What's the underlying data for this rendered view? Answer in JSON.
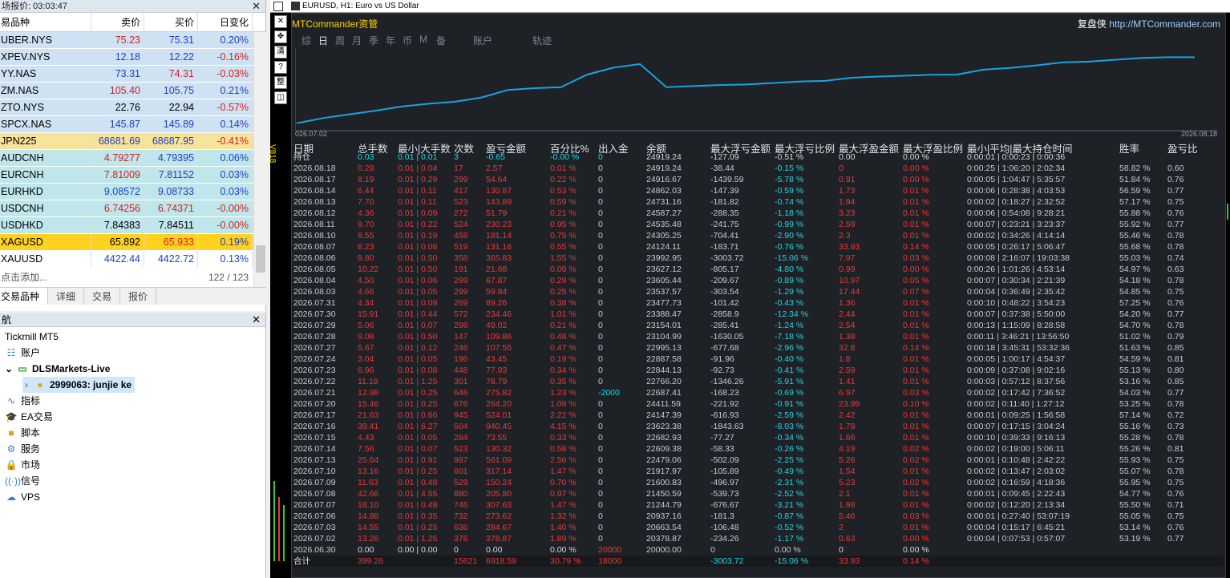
{
  "market_watch": {
    "title": "场报价: 03:03:47",
    "headers": [
      "易品种",
      "卖价",
      "买价",
      "日变化"
    ],
    "rows": [
      {
        "symbol": "UBER.NYS",
        "bid": "75.23",
        "ask": "75.31",
        "change": "0.20%",
        "bg": "#cfe2f3",
        "bid_color": "#d42020",
        "ask_color": "#1f3fbf",
        "chg_color": "#1f3fbf"
      },
      {
        "symbol": "XPEV.NYS",
        "bid": "12.18",
        "ask": "12.22",
        "change": "-0.16%",
        "bg": "#cfe2f3",
        "bid_color": "#1f3fbf",
        "ask_color": "#1f3fbf",
        "chg_color": "#d42020"
      },
      {
        "symbol": "YY.NAS",
        "bid": "73.31",
        "ask": "74.31",
        "change": "-0.03%",
        "bg": "#cfe2f3",
        "bid_color": "#1f3fbf",
        "ask_color": "#d42020",
        "chg_color": "#d42020"
      },
      {
        "symbol": "ZM.NAS",
        "bid": "105.40",
        "ask": "105.75",
        "change": "0.21%",
        "bg": "#cfe2f3",
        "bid_color": "#d42020",
        "ask_color": "#1f3fbf",
        "chg_color": "#1f3fbf"
      },
      {
        "symbol": "ZTO.NYS",
        "bid": "22.76",
        "ask": "22.94",
        "change": "-0.57%",
        "bg": "#cfe2f3",
        "bid_color": "#000000",
        "ask_color": "#000000",
        "chg_color": "#d42020"
      },
      {
        "symbol": "SPCX.NAS",
        "bid": "145.87",
        "ask": "145.89",
        "change": "0.14%",
        "bg": "#cfe2f3",
        "bid_color": "#1f3fbf",
        "ask_color": "#1f3fbf",
        "chg_color": "#1f3fbf"
      },
      {
        "symbol": "JPN225",
        "bid": "68681.69",
        "ask": "68687.95",
        "change": "-0.41%",
        "bg": "#f7e39a",
        "bid_color": "#1f3fbf",
        "ask_color": "#1f3fbf",
        "chg_color": "#d42020"
      },
      {
        "symbol": "AUDCNH",
        "bid": "4.79277",
        "ask": "4.79395",
        "change": "0.06%",
        "bg": "#bfe6ea",
        "bid_color": "#d42020",
        "ask_color": "#1f3fbf",
        "chg_color": "#1f3fbf"
      },
      {
        "symbol": "EURCNH",
        "bid": "7.81009",
        "ask": "7.81152",
        "change": "0.03%",
        "bg": "#bfe6ea",
        "bid_color": "#d42020",
        "ask_color": "#1f3fbf",
        "chg_color": "#1f3fbf"
      },
      {
        "symbol": "EURHKD",
        "bid": "9.08572",
        "ask": "9.08733",
        "change": "0.03%",
        "bg": "#bfe6ea",
        "bid_color": "#1f3fbf",
        "ask_color": "#1f3fbf",
        "chg_color": "#1f3fbf"
      },
      {
        "symbol": "USDCNH",
        "bid": "6.74256",
        "ask": "6.74371",
        "change": "-0.00%",
        "bg": "#bfe6ea",
        "bid_color": "#d42020",
        "ask_color": "#d42020",
        "chg_color": "#d42020"
      },
      {
        "symbol": "USDHKD",
        "bid": "7.84383",
        "ask": "7.84511",
        "change": "-0.00%",
        "bg": "#bfe6ea",
        "bid_color": "#000000",
        "ask_color": "#000000",
        "chg_color": "#d42020"
      },
      {
        "symbol": "XAGUSD",
        "bid": "65.892",
        "ask": "65.933",
        "change": "0.19%",
        "bg": "#ffd21f",
        "bid_color": "#000000",
        "ask_color": "#d42020",
        "chg_color": "#1f3fbf"
      },
      {
        "symbol": "XAUUSD",
        "bid": "4422.44",
        "ask": "4422.72",
        "change": "0.13%",
        "bg": "#ffffff",
        "bid_color": "#1f3fbf",
        "ask_color": "#1f3fbf",
        "chg_color": "#1f3fbf"
      }
    ],
    "add_hint": "点击添加...",
    "count": "122 / 123",
    "tabs": [
      "交易品种",
      "详细",
      "交易",
      "报价"
    ]
  },
  "navigator": {
    "title": "航",
    "broker": "Tickmill MT5",
    "items": [
      {
        "label": "账户",
        "icon": "accounts-icon"
      },
      {
        "label": "DLSMarkets-Live",
        "icon": "server-icon"
      },
      {
        "label": "2999063: junjie ke",
        "icon": "user-icon"
      },
      {
        "label": "指标",
        "icon": "indicator-icon"
      },
      {
        "label": "EA交易",
        "icon": "expert-icon"
      },
      {
        "label": "脚本",
        "icon": "script-icon"
      },
      {
        "label": "服务",
        "icon": "service-icon"
      },
      {
        "label": "市场",
        "icon": "market-icon"
      },
      {
        "label": "信号",
        "icon": "signal-icon"
      },
      {
        "label": "VPS",
        "icon": "cloud-icon"
      }
    ]
  },
  "chart_window": {
    "title": "EURUSD, H1:  Euro vs US Dollar",
    "side_label": "V818",
    "toolbar": [
      "✕",
      "✥",
      "清",
      "?",
      "整",
      "◫"
    ]
  },
  "panel": {
    "app_name": "MTCommander资管",
    "brand_cn": "复盘侠",
    "brand_url": "http://MTCommander.com",
    "periods": [
      "综",
      "日",
      "周",
      "月",
      "季",
      "年",
      "币",
      "M",
      "备"
    ],
    "period_selected": 1,
    "account_tab": "账户",
    "track_tab": "轨迹",
    "curve_start": "026.07.02",
    "curve_end": "2026.08.18"
  },
  "chart_data": {
    "type": "line",
    "x": [
      "2026.06.30",
      "2026.07.02",
      "2026.07.03",
      "2026.07.06",
      "2026.07.07",
      "2026.07.08",
      "2026.07.09",
      "2026.07.10",
      "2026.07.13",
      "2026.07.14",
      "2026.07.15",
      "2026.07.16",
      "2026.07.17",
      "2026.07.20",
      "2026.07.21",
      "2026.07.22",
      "2026.07.23",
      "2026.07.24",
      "2026.07.27",
      "2026.07.28",
      "2026.07.29",
      "2026.07.30",
      "2026.07.31",
      "2026.08.03",
      "2026.08.04",
      "2026.08.05",
      "2026.08.06",
      "2026.08.07",
      "2026.08.10",
      "2026.08.11",
      "2026.08.12",
      "2026.08.13",
      "2026.08.14",
      "2026.08.17",
      "2026.08.18"
    ],
    "values": [
      20000.0,
      20378.87,
      20663.54,
      20937.16,
      21244.79,
      21450.59,
      21600.83,
      21917.97,
      22479.06,
      22609.38,
      22682.93,
      23623.38,
      24147.39,
      24411.59,
      22687.41,
      22766.2,
      22844.13,
      22887.58,
      22995.13,
      23104.99,
      23154.01,
      23388.47,
      23477.73,
      23537.57,
      23605.44,
      23627.12,
      23992.95,
      24124.11,
      24305.25,
      24535.48,
      24587.27,
      24731.16,
      24862.03,
      24916.67,
      24919.24
    ]
  },
  "table": {
    "headers": [
      "日期",
      "总手数",
      "最小|大手数",
      "次数",
      "盈亏金额",
      "百分比%",
      "出入金",
      "余额",
      "最大浮亏金额",
      "最大浮亏比例",
      "最大浮盈金额",
      "最大浮盈比例",
      "最小|平均|最大持仓时间",
      "胜率",
      "盈亏比"
    ],
    "holding": {
      "label": "持仓",
      "lots": "0.03",
      "minmax": "0.01 | 0.01",
      "count": "3",
      "pnl": "-0.65",
      "pct": "-0.00 %",
      "flow": "0",
      "balance": "24919.24",
      "ddamt": "-127.09",
      "ddpct": "-0.51 %",
      "fpamt": "0.00",
      "fppct": "0.00 %",
      "time": "0:00:01 | 0:00:23 | 0:00:36",
      "win": "",
      "ratio": ""
    },
    "rows": [
      [
        "2026.08.18",
        "0.29",
        "0.01 | 0.04",
        "17",
        "2.57",
        "0.01 %",
        "0",
        "24919.24",
        "-38.44",
        "-0.15 %",
        "0",
        "0.00 %",
        "0:00:25 | 1:06:20 | 2:02:34",
        "58.82 %",
        "0.60"
      ],
      [
        "2026.08.17",
        "8.19",
        "0.01 | 0.29",
        "299",
        "54.64",
        "0.22 %",
        "0",
        "24916.67",
        "-1439.59",
        "-5.78 %",
        "0.91",
        "0.00 %",
        "0:00:05 | 1:04:47 | 5:35:57",
        "51.84 %",
        "0.76"
      ],
      [
        "2026.08.14",
        "6.44",
        "0.01 | 0.11",
        "417",
        "130.87",
        "0.53 %",
        "0",
        "24862.03",
        "-147.39",
        "-0.59 %",
        "1.73",
        "0.01 %",
        "0:00:06 | 0:28:38 | 4:03:53",
        "56.59 %",
        "0.77"
      ],
      [
        "2026.08.13",
        "7.70",
        "0.01 | 0.11",
        "523",
        "143.89",
        "0.59 %",
        "0",
        "24731.16",
        "-181.82",
        "-0.74 %",
        "1.94",
        "0.01 %",
        "0:00:02 | 0:18:27 | 2:32:52",
        "57.17 %",
        "0.75"
      ],
      [
        "2026.08.12",
        "4.36",
        "0.01 | 0.09",
        "272",
        "51.79",
        "0.21 %",
        "0",
        "24587.27",
        "-288.35",
        "-1.18 %",
        "3.23",
        "0.01 %",
        "0:00:06 | 0:54:08 | 9:28:21",
        "55.88 %",
        "0.76"
      ],
      [
        "2026.08.11",
        "9.70",
        "0.01 | 0.22",
        "524",
        "230.23",
        "0.95 %",
        "0",
        "24535.48",
        "-241.75",
        "-0.99 %",
        "2.59",
        "0.01 %",
        "0:00:07 | 0:23:21 | 3:23:37",
        "55.92 %",
        "0.77"
      ],
      [
        "2026.08.10",
        "8.55",
        "0.01 | 0.19",
        "458",
        "181.14",
        "0.75 %",
        "0",
        "24305.25",
        "-704.41",
        "-2.90 %",
        "2.3",
        "0.01 %",
        "0:00:02 | 0:34:26 | 4:14:14",
        "55.46 %",
        "0.78"
      ],
      [
        "2026.08.07",
        "8.23",
        "0.01 | 0.08",
        "519",
        "131.16",
        "0.55 %",
        "0",
        "24124.11",
        "-183.71",
        "-0.76 %",
        "33.93",
        "0.14 %",
        "0:00:05 | 0:26:17 | 5:06:47",
        "55.68 %",
        "0.78"
      ],
      [
        "2026.08.06",
        "9.80",
        "0.01 | 0.50",
        "358",
        "365.83",
        "1.55 %",
        "0",
        "23992.95",
        "-3003.72",
        "-15.06 %",
        "7.97",
        "0.03 %",
        "0:00:08 | 2:16:07 | 19:03:38",
        "55.03 %",
        "0.74"
      ],
      [
        "2026.08.05",
        "10.22",
        "0.01 | 0.50",
        "191",
        "21.68",
        "0.09 %",
        "0",
        "23627.12",
        "-805.17",
        "-4.80 %",
        "0.99",
        "0.00 %",
        "0:00:26 | 1:01:26 | 4:53:14",
        "54.97 %",
        "0.63"
      ],
      [
        "2026.08.04",
        "4.50",
        "0.01 | 0.06",
        "299",
        "67.87",
        "0.29 %",
        "0",
        "23605.44",
        "-209.67",
        "-0.89 %",
        "10.97",
        "0.05 %",
        "0:00:07 | 0:30:34 | 2:21:39",
        "54.18 %",
        "0.78"
      ],
      [
        "2026.08.03",
        "4.66",
        "0.01 | 0.05",
        "299",
        "59.84",
        "0.25 %",
        "0",
        "23537.57",
        "-303.54",
        "-1.29 %",
        "17.44",
        "0.07 %",
        "0:00:04 | 0:36:49 | 2:35:42",
        "54.85 %",
        "0.75"
      ],
      [
        "2026.07.31",
        "4.34",
        "0.01 | 0.09",
        "269",
        "89.26",
        "0.38 %",
        "0",
        "23477.73",
        "-101.42",
        "-0.43 %",
        "1.36",
        "0.01 %",
        "0:00:10 | 0:48:22 | 3:54:23",
        "57.25 %",
        "0.76"
      ],
      [
        "2026.07.30",
        "15.91",
        "0.01 | 0.44",
        "572",
        "234.46",
        "1.01 %",
        "0",
        "23388.47",
        "-2858.9",
        "-12.34 %",
        "2.44",
        "0.01 %",
        "0:00:07 | 0:37:38 | 5:50:00",
        "54.20 %",
        "0.77"
      ],
      [
        "2026.07.29",
        "5.06",
        "0.01 | 0.07",
        "298",
        "49.02",
        "0.21 %",
        "0",
        "23154.01",
        "-285.41",
        "-1.24 %",
        "2.54",
        "0.01 %",
        "0:00:13 | 1:15:09 | 8:28:58",
        "54.70 %",
        "0.78"
      ],
      [
        "2026.07.28",
        "9.08",
        "0.01 | 0.50",
        "147",
        "109.86",
        "0.48 %",
        "0",
        "23104.99",
        "-1630.05",
        "-7.18 %",
        "1.38",
        "0.01 %",
        "0:00:11 | 3:46:21 | 13:56:50",
        "51.02 %",
        "0.79"
      ],
      [
        "2026.07.27",
        "5.67",
        "0.01 | 0.12",
        "246",
        "107.55",
        "0.47 %",
        "0",
        "22995.13",
        "-677.68",
        "-2.96 %",
        "32.8",
        "0.14 %",
        "0:00:18 | 3:45:31 | 53:32:36",
        "51.63 %",
        "0.85"
      ],
      [
        "2026.07.24",
        "3.04",
        "0.01 | 0.05",
        "196",
        "43.45",
        "0.19 %",
        "0",
        "22887.58",
        "-91.96",
        "-0.40 %",
        "1.8",
        "0.01 %",
        "0:00:05 | 1:00:17 | 4:54:37",
        "54.59 %",
        "0.81"
      ],
      [
        "2026.07.23",
        "6.96",
        "0.01 | 0.08",
        "448",
        "77.93",
        "0.34 %",
        "0",
        "22844.13",
        "-92.73",
        "-0.41 %",
        "2.59",
        "0.01 %",
        "0:00:09 | 0:37:08 | 9:02:16",
        "55.13 %",
        "0.80"
      ],
      [
        "2026.07.22",
        "11.18",
        "0.01 | 1.25",
        "301",
        "78.79",
        "0.35 %",
        "0",
        "22766.20",
        "-1346.26",
        "-5.91 %",
        "1.41",
        "0.01 %",
        "0:00:03 | 0:57:12 | 8:37:56",
        "53.16 %",
        "0.85"
      ],
      [
        "2026.07.21",
        "12.98",
        "0.01 | 0.25",
        "646",
        "275.82",
        "1.23 %",
        "-2000",
        "22687.41",
        "-168.23",
        "-0.69 %",
        "6.97",
        "0.03 %",
        "0:00:02 | 0:17:42 | 7:36:52",
        "54.03 %",
        "0.77"
      ],
      [
        "2026.07.20",
        "15.46",
        "0.01 | 0.25",
        "676",
        "264.20",
        "1.09 %",
        "0",
        "24411.59",
        "-221.92",
        "-0.91 %",
        "23.99",
        "0.10 %",
        "0:00:02 | 0:11:40 | 1:27:12",
        "53.25 %",
        "0.78"
      ],
      [
        "2026.07.17",
        "21.63",
        "0.01 | 0.66",
        "945",
        "524.01",
        "2.22 %",
        "0",
        "24147.39",
        "-616.93",
        "-2.59 %",
        "2.42",
        "0.01 %",
        "0:00:01 | 0:09:25 | 1:56:58",
        "57.14 %",
        "0.72"
      ],
      [
        "2026.07.16",
        "39.41",
        "0.01 | 6.27",
        "504",
        "940.45",
        "4.15 %",
        "0",
        "23623.38",
        "-1843.63",
        "-8.03 %",
        "1.78",
        "0.01 %",
        "0:00:07 | 0:17:15 | 3:04:24",
        "55.16 %",
        "0.73"
      ],
      [
        "2026.07.15",
        "4.43",
        "0.01 | 0.05",
        "284",
        "73.55",
        "0.33 %",
        "0",
        "22682.93",
        "-77.27",
        "-0.34 %",
        "1.66",
        "0.01 %",
        "0:00:10 | 0:39:33 | 9:16:13",
        "55.28 %",
        "0.78"
      ],
      [
        "2026.07.14",
        "7.56",
        "0.01 | 0.07",
        "523",
        "130.32",
        "0.58 %",
        "0",
        "22609.38",
        "-58.33",
        "-0.26 %",
        "4.19",
        "0.02 %",
        "0:00:02 | 0:19:00 | 5:06:11",
        "55.26 %",
        "0.81"
      ],
      [
        "2026.07.13",
        "25.64",
        "0.01 | 0.91",
        "987",
        "561.09",
        "2.56 %",
        "0",
        "22479.06",
        "-502.09",
        "-2.25 %",
        "5.26",
        "0.02 %",
        "0:00:01 | 0:10:48 | 2:42:22",
        "55.93 %",
        "0.75"
      ],
      [
        "2026.07.10",
        "13.16",
        "0.01 | 0.25",
        "601",
        "317.14",
        "1.47 %",
        "0",
        "21917.97",
        "-105.89",
        "-0.49 %",
        "1.54",
        "0.01 %",
        "0:00:02 | 0:13:47 | 2:03:02",
        "55.07 %",
        "0.78"
      ],
      [
        "2026.07.09",
        "11.63",
        "0.01 | 0.48",
        "529",
        "150.24",
        "0.70 %",
        "0",
        "21600.83",
        "-496.97",
        "-2.31 %",
        "5.23",
        "0.02 %",
        "0:00:02 | 0:16:59 | 4:18:36",
        "55.95 %",
        "0.75"
      ],
      [
        "2026.07.08",
        "42.66",
        "0.01 | 4.55",
        "880",
        "205.80",
        "0.97 %",
        "0",
        "21450.59",
        "-539.73",
        "-2.52 %",
        "2.1",
        "0.01 %",
        "0:00:01 | 0:09:45 | 2:22:43",
        "54.77 %",
        "0.76"
      ],
      [
        "2026.07.07",
        "18.10",
        "0.01 | 0.48",
        "746",
        "307.63",
        "1.47 %",
        "0",
        "21244.79",
        "-676.67",
        "-3.21 %",
        "1.98",
        "0.01 %",
        "0:00:02 | 0:12:20 | 2:13:34",
        "55.50 %",
        "0.71"
      ],
      [
        "2026.07.06",
        "14.88",
        "0.01 | 0.35",
        "732",
        "273.62",
        "1.32 %",
        "0",
        "20937.16",
        "-181.3",
        "-0.87 %",
        "5.46",
        "0.03 %",
        "0:00:01 | 0:27:40 | 53:07:19",
        "55.05 %",
        "0.75"
      ],
      [
        "2026.07.03",
        "14.55",
        "0.01 | 0.25",
        "636",
        "284.67",
        "1.40 %",
        "0",
        "20663.54",
        "-106.48",
        "-0.52 %",
        "2",
        "0.01 %",
        "0:00:04 | 0:15:17 | 6:45:21",
        "53.14 %",
        "0.76"
      ],
      [
        "2026.07.02",
        "13.26",
        "0.01 | 1.25",
        "376",
        "378.87",
        "1.89 %",
        "0",
        "20378.87",
        "-234.26",
        "-1.17 %",
        "0.63",
        "0.00 %",
        "0:00:04 | 0:07:53 | 0:57:07",
        "53.19 %",
        "0.77"
      ],
      [
        "2026.06.30",
        "0.00",
        "0.00 | 0.00",
        "0",
        "0.00",
        "0.00 %",
        "20000",
        "20000.00",
        "0",
        "0.00 %",
        "0",
        "0.00 %",
        "",
        "",
        ""
      ]
    ],
    "total": {
      "label": "合计",
      "lots": "399.26",
      "minmax": "",
      "count": "15621",
      "pnl": "6918.59",
      "pct": "30.79 %",
      "flow": "18000",
      "balance": "",
      "ddamt": "-3003.72",
      "ddpct": "-15.06 %",
      "fpamt": "33.93",
      "fppct": "0.14 %"
    }
  }
}
